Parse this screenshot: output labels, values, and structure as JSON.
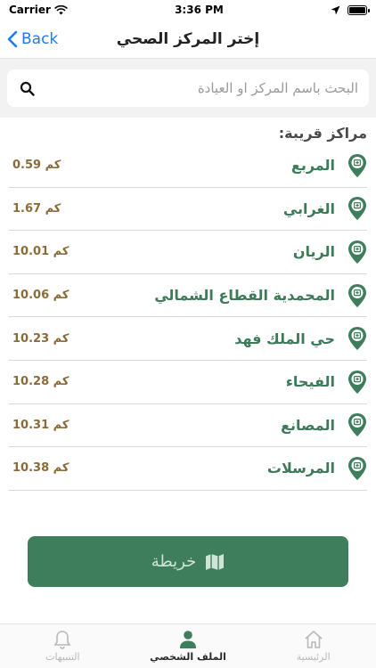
{
  "status_bar": {
    "carrier": "Carrier",
    "time": "3:36 PM",
    "battery_level": 0.9
  },
  "nav": {
    "back_label": "Back",
    "title": "إختر المركز الصحي"
  },
  "search": {
    "placeholder": "البحث باسم المركز او العيادة",
    "value": ""
  },
  "section": {
    "title": "مراكز قريبة:"
  },
  "centers": [
    {
      "name": "المربع",
      "distance": "0.59 كم"
    },
    {
      "name": "الغرابي",
      "distance": "1.67 كم"
    },
    {
      "name": "الريان",
      "distance": "10.01 كم"
    },
    {
      "name": "المحمدية القطاع الشمالي",
      "distance": "10.06 كم"
    },
    {
      "name": "حي الملك فهد",
      "distance": "10.23 كم"
    },
    {
      "name": "الفيحاء",
      "distance": "10.28 كم"
    },
    {
      "name": "المصانع",
      "distance": "10.31 كم"
    },
    {
      "name": "المرسلات",
      "distance": "10.38 كم"
    }
  ],
  "map_button": {
    "label": "خريطة",
    "icon": "map-icon"
  },
  "tabs": [
    {
      "label": "التنبيهات",
      "icon": "bell-icon",
      "active": false
    },
    {
      "label": "الملف الشخصي",
      "icon": "person-icon",
      "active": true
    },
    {
      "label": "الرئيسية",
      "icon": "home-icon",
      "active": false
    }
  ],
  "colors": {
    "accent_green": "#3f7e5c",
    "name_green": "#3c7a58",
    "distance_brown": "#8a6b3a",
    "ios_blue": "#1a7cf5"
  }
}
